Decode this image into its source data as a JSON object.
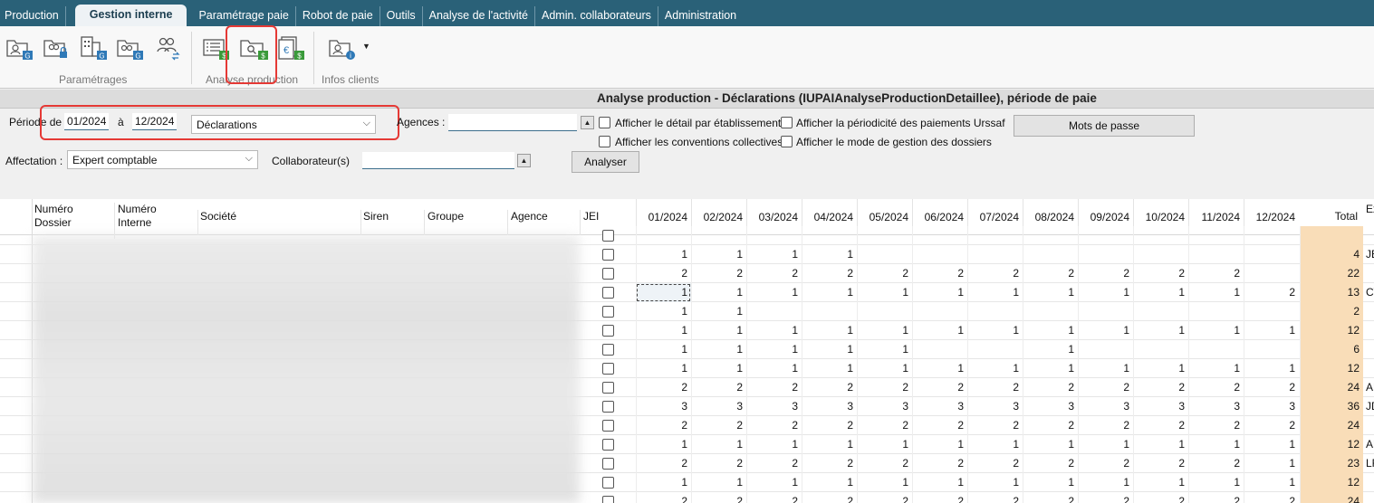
{
  "menu": {
    "tabs": [
      "Production",
      "Gestion interne",
      "Paramétrage paie",
      "Robot de paie",
      "Outils",
      "Analyse de l'activité",
      "Admin. collaborateurs",
      "Administration"
    ],
    "active": "Gestion interne"
  },
  "ribbon": {
    "groups": {
      "parametrages": "Paramétrages",
      "analyse": "Analyse production",
      "infos": "Infos clients"
    }
  },
  "page": {
    "title": "Analyse production - Déclarations (IUPAIAnalyseProductionDetaillee), période de paie"
  },
  "filters": {
    "period_label": "Période de",
    "period_from": "01/2024",
    "period_to_label": "à",
    "period_to": "12/2024",
    "type_value": "Déclarations",
    "agences_label": "Agences :",
    "agences_value": "",
    "affectation_label": "Affectation :",
    "affectation_value": "Expert comptable",
    "collaborateur_label": "Collaborateur(s)",
    "collaborateur_value": "",
    "opt_detail": "Afficher le détail par établissement",
    "opt_conventions": "Afficher les conventions collectives",
    "opt_periodicite": "Afficher la périodicité des paiements Urssaf",
    "opt_mode": "Afficher le mode de gestion des dossiers",
    "btn_mots_de_passe": "Mots de passe",
    "btn_analyser": "Analyser"
  },
  "grid": {
    "headers": {
      "numero_dossier": "Numéro\nDossier",
      "numero_interne": "Numéro\nInterne",
      "societe": "Société",
      "siren": "Siren",
      "groupe": "Groupe",
      "agence": "Agence",
      "jei": "JEI",
      "months": [
        "01/2024",
        "02/2024",
        "03/2024",
        "04/2024",
        "05/2024",
        "06/2024",
        "07/2024",
        "08/2024",
        "09/2024",
        "10/2024",
        "11/2024",
        "12/2024"
      ],
      "total": "Total",
      "ext": "Ex"
    },
    "rows": [
      {
        "m": [
          "",
          "",
          "",
          "",
          "",
          "",
          "",
          "",
          "",
          "",
          "",
          ""
        ],
        "total": "",
        "ext": ""
      },
      {
        "m": [
          "1",
          "1",
          "1",
          "1",
          "",
          "",
          "",
          "",
          "",
          "",
          "",
          ""
        ],
        "total": "4",
        "ext": "JE"
      },
      {
        "m": [
          "2",
          "2",
          "2",
          "2",
          "2",
          "2",
          "2",
          "2",
          "2",
          "2",
          "2",
          ""
        ],
        "total": "22",
        "ext": ""
      },
      {
        "m": [
          "1",
          "1",
          "1",
          "1",
          "1",
          "1",
          "1",
          "1",
          "1",
          "1",
          "1",
          "2"
        ],
        "total": "13",
        "ext": "CV"
      },
      {
        "m": [
          "1",
          "1",
          "",
          "",
          "",
          "",
          "",
          "",
          "",
          "",
          "",
          ""
        ],
        "total": "2",
        "ext": ""
      },
      {
        "m": [
          "1",
          "1",
          "1",
          "1",
          "1",
          "1",
          "1",
          "1",
          "1",
          "1",
          "1",
          "1"
        ],
        "total": "12",
        "ext": ""
      },
      {
        "m": [
          "1",
          "1",
          "1",
          "1",
          "1",
          "",
          "",
          "1",
          "",
          "",
          "",
          ""
        ],
        "total": "6",
        "ext": ""
      },
      {
        "m": [
          "1",
          "1",
          "1",
          "1",
          "1",
          "1",
          "1",
          "1",
          "1",
          "1",
          "1",
          "1"
        ],
        "total": "12",
        "ext": ""
      },
      {
        "m": [
          "2",
          "2",
          "2",
          "2",
          "2",
          "2",
          "2",
          "2",
          "2",
          "2",
          "2",
          "2"
        ],
        "total": "24",
        "ext": "AF"
      },
      {
        "m": [
          "3",
          "3",
          "3",
          "3",
          "3",
          "3",
          "3",
          "3",
          "3",
          "3",
          "3",
          "3"
        ],
        "total": "36",
        "ext": "JD"
      },
      {
        "m": [
          "2",
          "2",
          "2",
          "2",
          "2",
          "2",
          "2",
          "2",
          "2",
          "2",
          "2",
          "2"
        ],
        "total": "24",
        "ext": ""
      },
      {
        "m": [
          "1",
          "1",
          "1",
          "1",
          "1",
          "1",
          "1",
          "1",
          "1",
          "1",
          "1",
          "1"
        ],
        "total": "12",
        "ext": "AF"
      },
      {
        "m": [
          "2",
          "2",
          "2",
          "2",
          "2",
          "2",
          "2",
          "2",
          "2",
          "2",
          "2",
          "1"
        ],
        "total": "23",
        "ext": "LF"
      },
      {
        "m": [
          "1",
          "1",
          "1",
          "1",
          "1",
          "1",
          "1",
          "1",
          "1",
          "1",
          "1",
          "1"
        ],
        "total": "12",
        "ext": ""
      },
      {
        "m": [
          "2",
          "2",
          "2",
          "2",
          "2",
          "2",
          "2",
          "2",
          "2",
          "2",
          "2",
          "2"
        ],
        "total": "24",
        "ext": ""
      }
    ]
  },
  "colors": {
    "menubar": "#2a6178",
    "total_column": "#f9ddb8",
    "highlight": "#e53935"
  }
}
